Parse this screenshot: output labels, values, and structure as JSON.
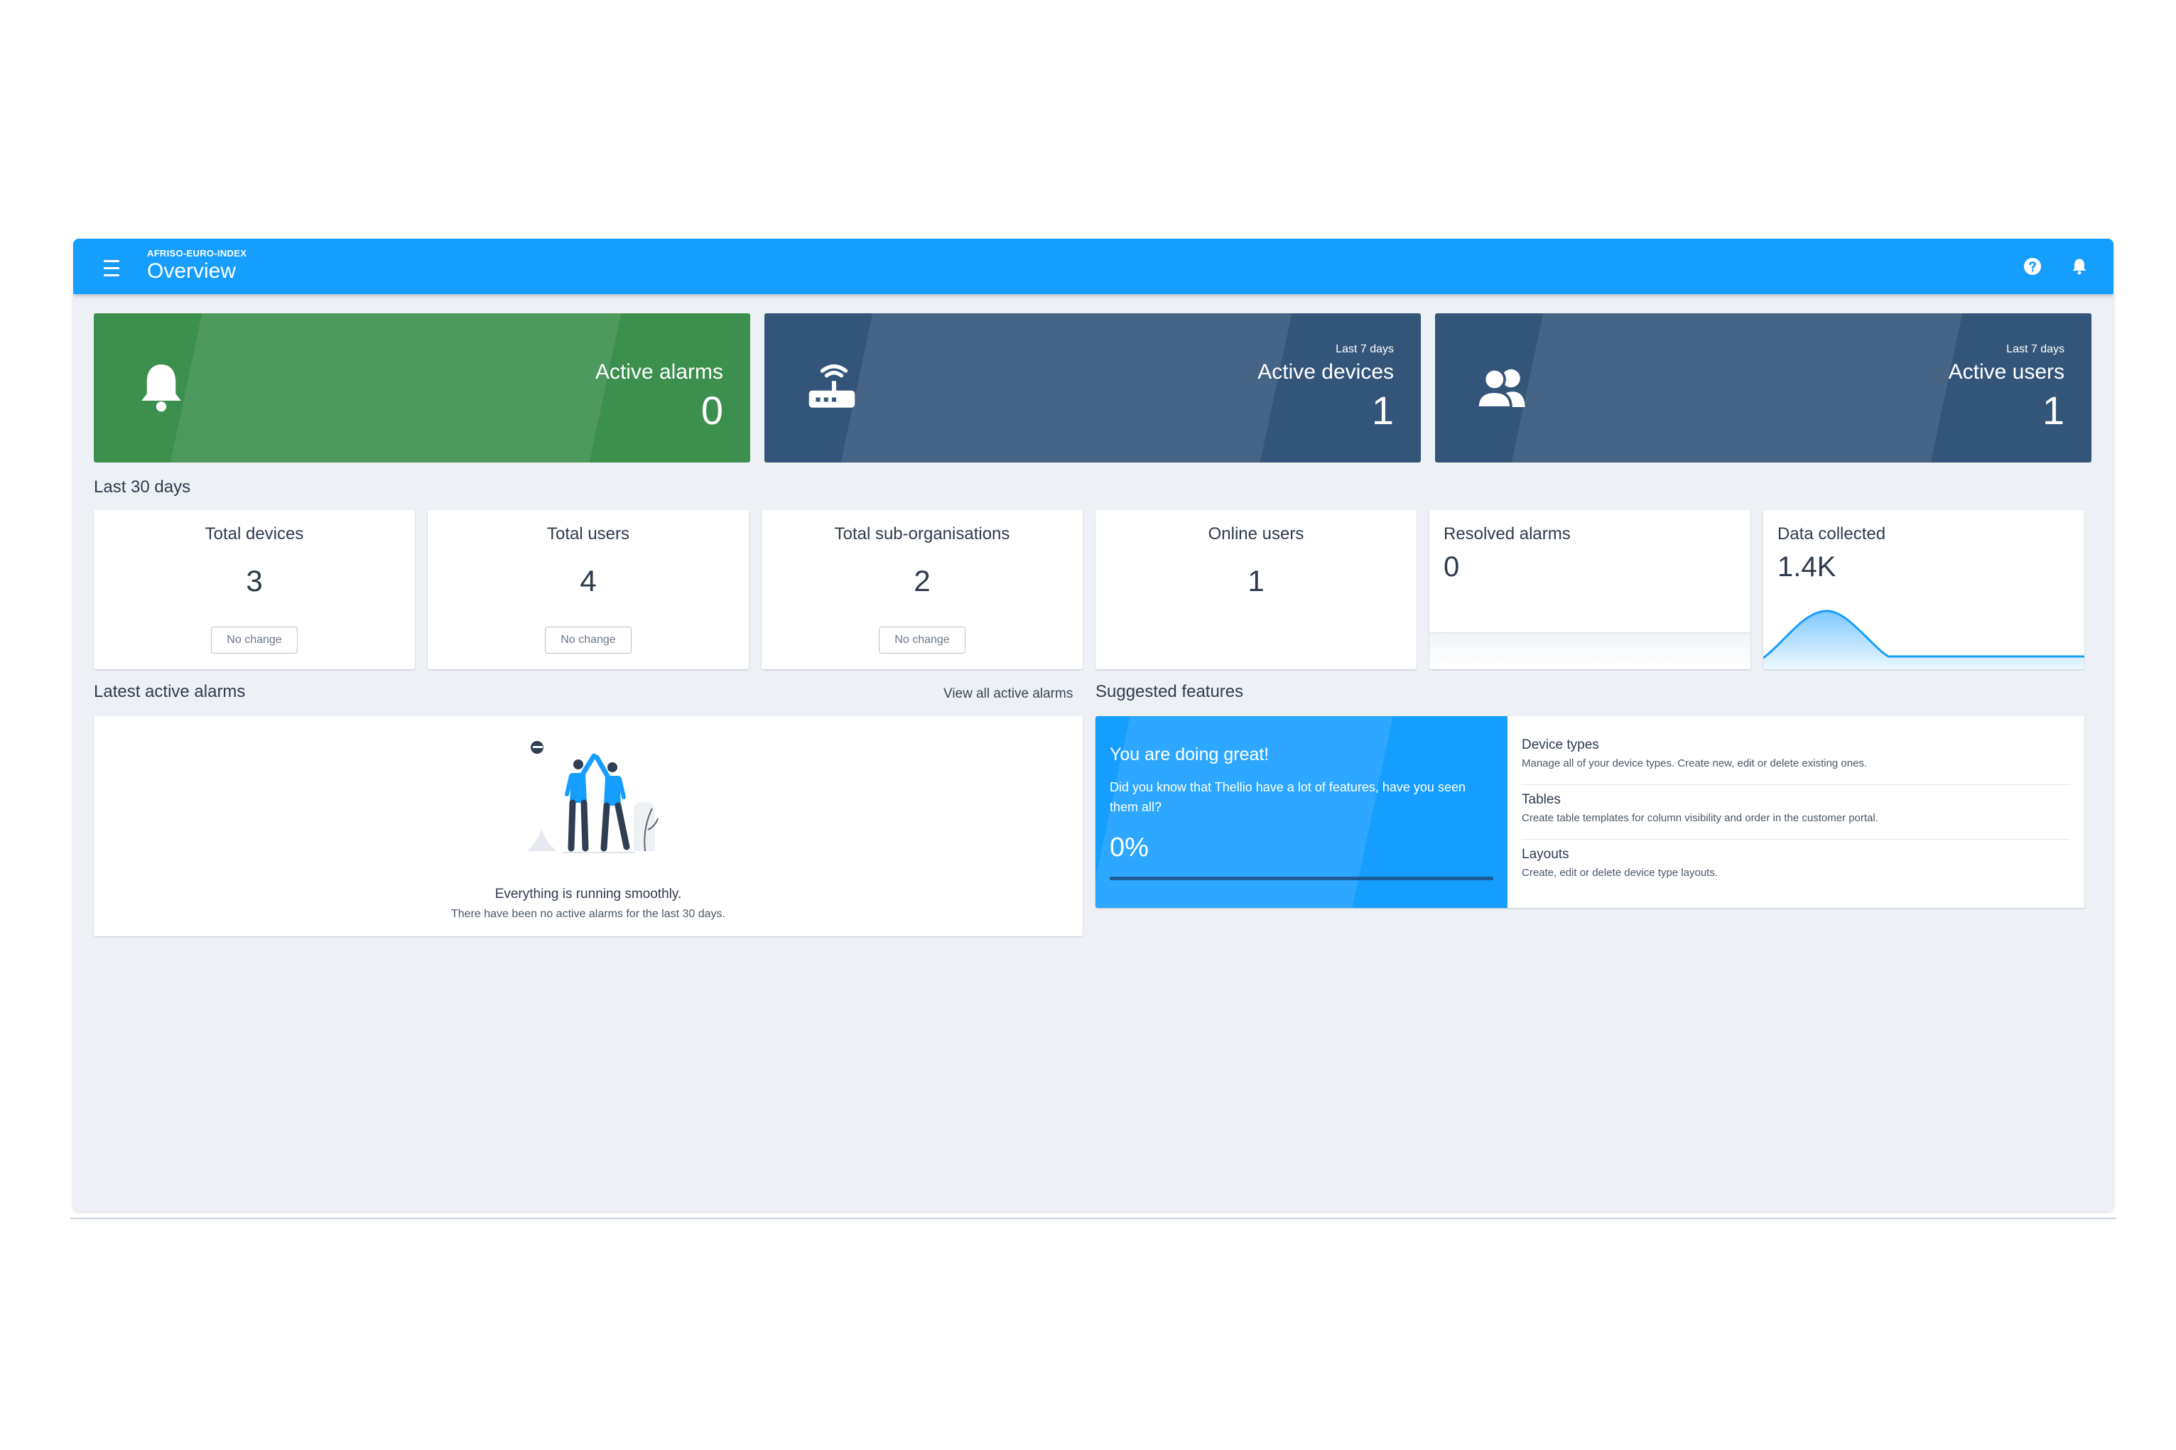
{
  "header": {
    "org": "AFRISO-EURO-INDEX",
    "title": "Overview",
    "icons": [
      "menu-icon",
      "help-icon",
      "bell-icon",
      "account-settings-icon"
    ]
  },
  "kpis": [
    {
      "label": "Active alarms",
      "sub": "",
      "value": "0",
      "icon": "bell-icon",
      "color": "#3d8f4d"
    },
    {
      "label": "Active devices",
      "sub": "Last 7 days",
      "value": "1",
      "icon": "router-icon",
      "color": "#34557a"
    },
    {
      "label": "Active users",
      "sub": "Last 7 days",
      "value": "1",
      "icon": "users-icon",
      "color": "#34557a"
    }
  ],
  "last30": {
    "heading": "Last 30 days",
    "stats": [
      {
        "title": "Total devices",
        "value": "3",
        "badge": "No change"
      },
      {
        "title": "Total users",
        "value": "4",
        "badge": "No change"
      },
      {
        "title": "Total sub-organisations",
        "value": "2",
        "badge": "No change"
      },
      {
        "title": "Online users",
        "value": "1",
        "badge": ""
      },
      {
        "title": "Resolved alarms",
        "value": "0",
        "badge": ""
      },
      {
        "title": "Data collected",
        "value": "1.4K",
        "badge": ""
      }
    ]
  },
  "alarms": {
    "heading": "Latest active alarms",
    "view_all": "View all active alarms",
    "empty_title": "Everything is running smoothly.",
    "empty_sub": "There have been no active alarms for the last 30 days."
  },
  "features": {
    "heading": "Suggested features",
    "promo_title": "You are doing great!",
    "promo_text": "Did you know that Thellio have a lot of features, have you seen them all?",
    "promo_percent": "0%",
    "progress": 0,
    "items": [
      {
        "title": "Device types",
        "desc": "Manage all of your device types. Create new, edit or delete existing ones."
      },
      {
        "title": "Tables",
        "desc": "Create table templates for column visibility and order in the customer portal."
      },
      {
        "title": "Layouts",
        "desc": "Create, edit or delete device type layouts."
      }
    ]
  },
  "colors": {
    "primary": "#169eff",
    "success": "#3d8f4d",
    "dark": "#34557a",
    "background": "#edf1f5"
  }
}
